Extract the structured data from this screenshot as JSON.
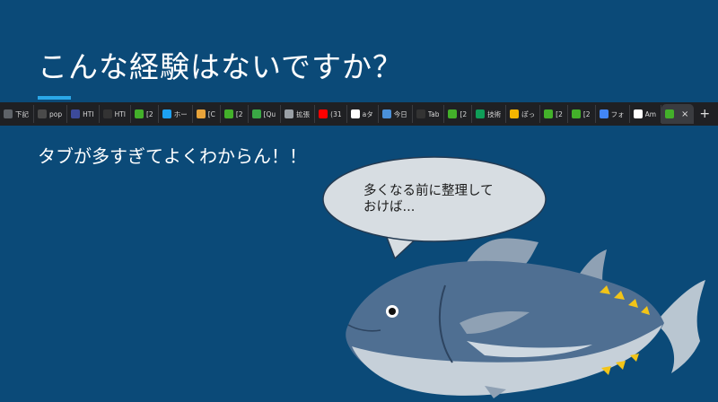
{
  "slide": {
    "title": "こんな経験はないですか？",
    "body": "タブが多すぎてよくわからん！！",
    "speech": "多くなる前に整理して\nおけば..."
  },
  "tabs": [
    {
      "label": "下記",
      "icon": "keyboard-icon",
      "color": "#5f6368"
    },
    {
      "label": "pop",
      "icon": "globe-icon",
      "color": "#4a4a4a"
    },
    {
      "label": "HTI",
      "icon": "code-icon",
      "color": "#3c4a9a"
    },
    {
      "label": "HTI",
      "icon": "github-icon",
      "color": "#333333"
    },
    {
      "label": "[2",
      "icon": "green-smile-icon",
      "color": "#43b02a"
    },
    {
      "label": "ホー",
      "icon": "twitter-icon",
      "color": "#1da1f2"
    },
    {
      "label": "[C",
      "icon": "folder-icon",
      "color": "#e8a33a"
    },
    {
      "label": "[2",
      "icon": "green-smile-icon",
      "color": "#43b02a"
    },
    {
      "label": "[Qu",
      "icon": "tree-icon",
      "color": "#3aa845"
    },
    {
      "label": "拡張",
      "icon": "puzzle-icon",
      "color": "#9aa0a6"
    },
    {
      "label": "(31",
      "icon": "youtube-icon",
      "color": "#ff0000"
    },
    {
      "label": "aタ",
      "icon": "google-icon",
      "color": "#ffffff"
    },
    {
      "label": "今日",
      "icon": "external-link-icon",
      "color": "#4a90d9"
    },
    {
      "label": "Tab",
      "icon": "github-icon",
      "color": "#333333"
    },
    {
      "label": "[2",
      "icon": "green-smile-icon",
      "color": "#43b02a"
    },
    {
      "label": "技術",
      "icon": "sheets-icon",
      "color": "#0f9d58"
    },
    {
      "label": "ぽっ",
      "icon": "slides-icon",
      "color": "#f4b400"
    },
    {
      "label": "[2",
      "icon": "green-smile-icon",
      "color": "#43b02a"
    },
    {
      "label": "[2",
      "icon": "green-smile-icon",
      "color": "#43b02a"
    },
    {
      "label": "フォ",
      "icon": "calendar-icon",
      "color": "#4285f4"
    },
    {
      "label": "Am",
      "icon": "amazon-icon",
      "color": "#ffffff"
    }
  ],
  "active_tab": {
    "icon": "green-smile-icon",
    "close": "×"
  },
  "new_tab": "+"
}
